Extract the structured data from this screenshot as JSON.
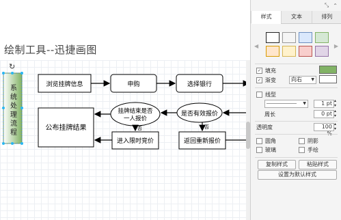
{
  "canvas": {
    "title": "绘制工具--迅捷画图",
    "lane_label": "系统处理流程"
  },
  "flow": {
    "nodes": {
      "browse": "浏览挂牌信息",
      "subscribe": "申购",
      "select_bank": "选择银行",
      "publish_result": "公布挂牌结果",
      "listing_over": "挂牌结束是否一人报价",
      "valid_offer": "是否有效报价",
      "timed_bid": "进入限时竞价",
      "requote": "返回重新报价"
    },
    "edge_labels": {
      "no1": "否",
      "no2": "否"
    }
  },
  "panel": {
    "top_icons": {
      "resize": "⤡",
      "collapse": "⌃"
    },
    "tabs": [
      "样式",
      "文本",
      "排列"
    ],
    "fill_label": "填充",
    "gradient_label": "渐变",
    "gradient_direction": "向右",
    "line_label": "线型",
    "line_width": "1 pt",
    "perimeter_label": "周长",
    "perimeter_value": "0 pt",
    "opacity_label": "透明度",
    "opacity_value": "100 %",
    "rounded_label": "圆角",
    "shadow_label": "阴影",
    "glass_label": "玻璃",
    "sketch_label": "手绘",
    "copy_style": "复制样式",
    "paste_style": "粘贴样式",
    "set_default": "设置为默认样式",
    "colors": {
      "fill_swatch": "#82b366",
      "gradient_swatch": "#ffffff",
      "swatch_row1": [
        "#ffffff",
        "#f5f5f5",
        "#dae8fc",
        "#d5e8d4"
      ],
      "swatch_row2": [
        "#ffe6cc",
        "#fff2cc",
        "#f8cecc",
        "#e1d5e7"
      ]
    }
  }
}
